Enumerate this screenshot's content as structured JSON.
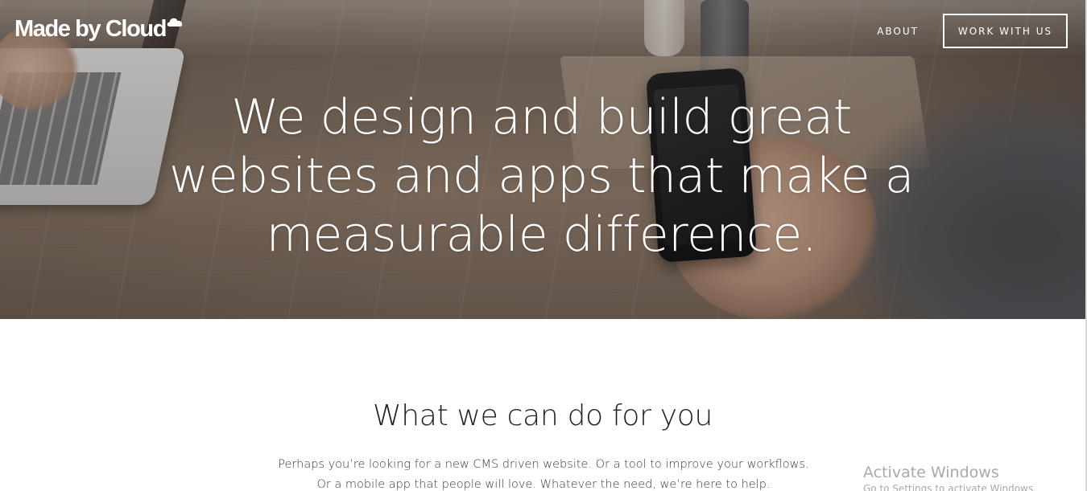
{
  "header": {
    "logo_text": "Made by Cloud",
    "logo_icon": "cloud-icon",
    "nav": {
      "about_label": "ABOUT",
      "cta_label": "WORK WITH US"
    }
  },
  "hero": {
    "title": "We design and build great websites and apps that make a measurable difference."
  },
  "services": {
    "title": "What we can do for you",
    "body_line1": "Perhaps you’re looking for a new CMS driven website. Or a tool to improve your workflows.",
    "body_line2": "Or a mobile app that people will love. Whatever the need, we’re here to help."
  },
  "os_watermark": {
    "title": "Activate Windows",
    "subtitle": "Go to Settings to activate Windows."
  },
  "colors": {
    "text_light": "#ffffff",
    "text_dark": "#222222",
    "watermark": "#a9a9a9"
  }
}
